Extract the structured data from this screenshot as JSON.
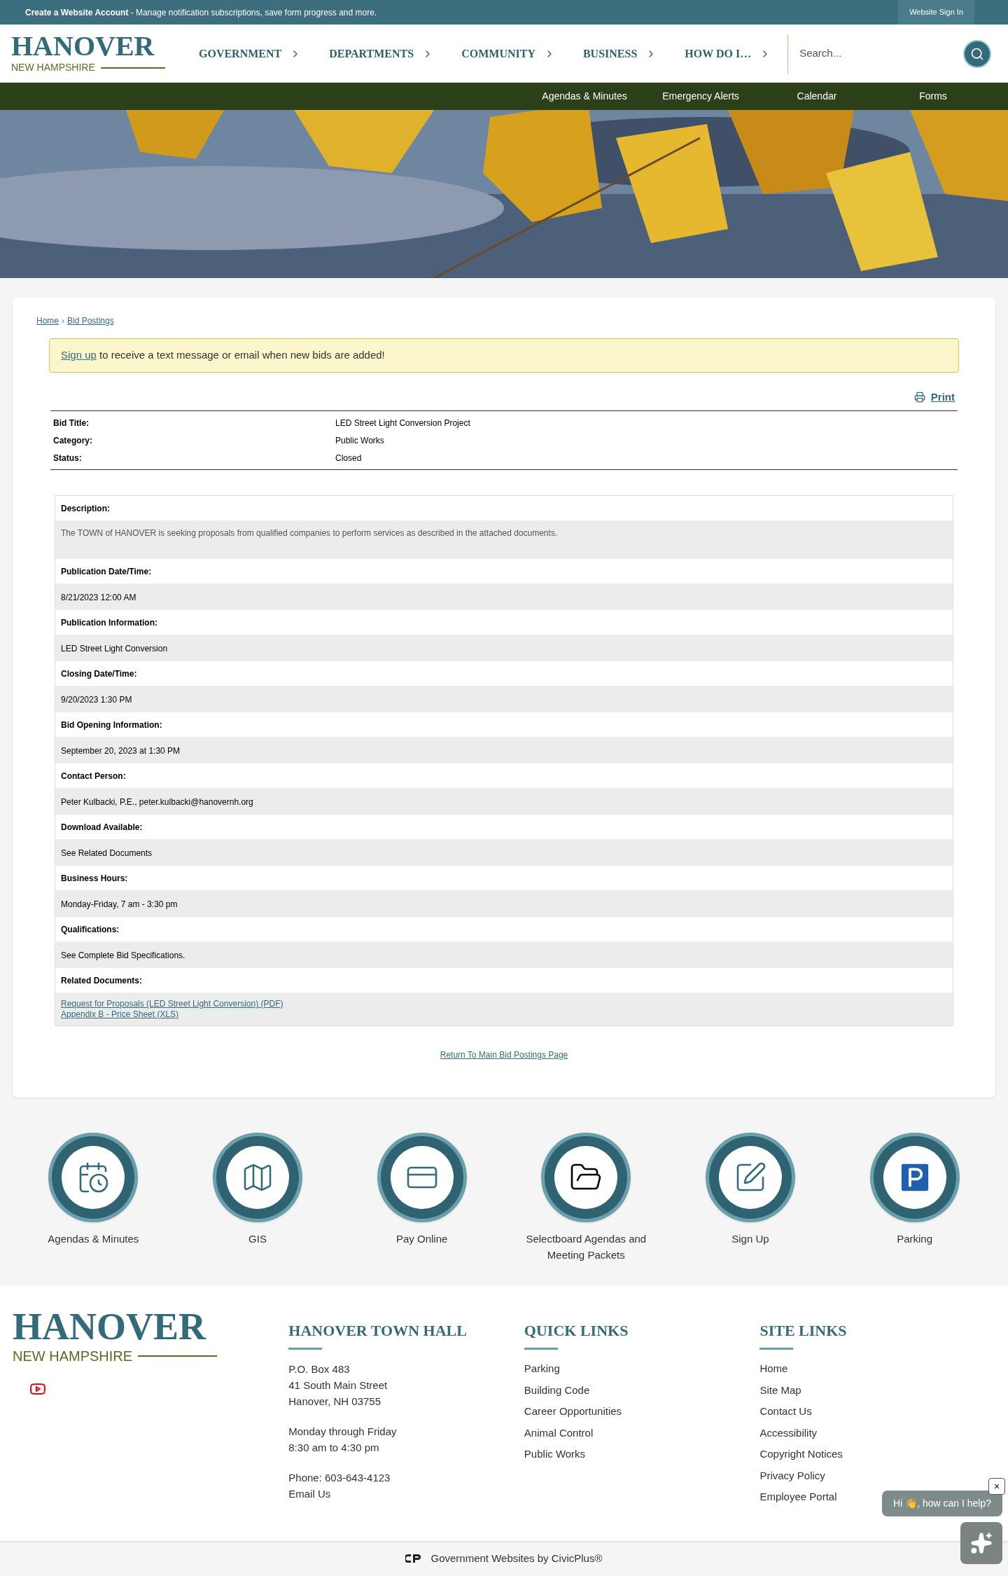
{
  "top_bar": {
    "account_link": "Create a Website Account",
    "account_text": " - Manage notification subscriptions, save form progress and more.",
    "sign_in": "Website Sign In"
  },
  "header_logo": {
    "title": "HANOVER",
    "subtitle": "NEW HAMPSHIRE"
  },
  "nav": [
    "GOVERNMENT",
    "DEPARTMENTS",
    "COMMUNITY",
    "BUSINESS",
    "HOW DO I…"
  ],
  "search": {
    "placeholder": "Search..."
  },
  "subnav": [
    "Agendas & Minutes",
    "Emergency Alerts",
    "Calendar",
    "Forms"
  ],
  "banner": {
    "kind": "picture"
  },
  "breadcrumb": {
    "items": [
      "Home",
      "Bid Postings"
    ],
    "separator": "›"
  },
  "notice": {
    "link": "Sign up",
    "text": " to receive a text message or email when new bids are added!"
  },
  "print": "Print",
  "summary": [
    {
      "label": "Bid Title:",
      "value": "LED Street Light Conversion Project"
    },
    {
      "label": "Category:",
      "value": "Public Works"
    },
    {
      "label": "Status:",
      "value": "Closed"
    }
  ],
  "details": [
    {
      "label": "Description:",
      "kind": "text",
      "value": "The TOWN of HANOVER is seeking proposals from qualified companies to perform services as described in the attached documents."
    },
    {
      "label": "Publication Date/Time:",
      "kind": "text",
      "value": "8/21/2023 12:00 AM"
    },
    {
      "label": "Publication Information:",
      "kind": "text",
      "value": "LED Street Light Conversion"
    },
    {
      "label": "Closing Date/Time:",
      "kind": "text",
      "value": "9/20/2023 1:30 PM"
    },
    {
      "label": "Bid Opening Information:",
      "kind": "text",
      "value": "September 20, 2023 at 1:30 PM"
    },
    {
      "label": "Contact Person:",
      "kind": "text",
      "value": "Peter Kulbacki, P.E., peter.kulbacki@hanovernh.org"
    },
    {
      "label": "Download Available:",
      "kind": "text",
      "value": "See Related Documents"
    },
    {
      "label": "Business Hours:",
      "kind": "text",
      "value": "Monday-Friday, 7 am - 3:30 pm"
    },
    {
      "label": "Qualifications:",
      "kind": "text",
      "value": "See Complete Bid Specifications."
    },
    {
      "label": "Related Documents:",
      "kind": "links",
      "links": [
        "Request for Proposals (LED Street Light Conversion) (PDF)",
        "Appendix B - Price Sheet (XLS)"
      ]
    }
  ],
  "return_link": "Return To Main Bid Postings Page",
  "quick_icons": [
    {
      "label": "Agendas & Minutes",
      "kind": "calendar"
    },
    {
      "label": "GIS",
      "kind": "map"
    },
    {
      "label": "Pay Online",
      "kind": "card"
    },
    {
      "label": "Selectboard Agendas and Meeting Packets",
      "kind": "folder"
    },
    {
      "label": "Sign Up",
      "kind": "pen"
    },
    {
      "label": "Parking",
      "kind": "parking"
    }
  ],
  "footer": {
    "logo": {
      "title": "HANOVER",
      "subtitle": "NEW HAMPSHIRE"
    },
    "town_hall": {
      "heading": "HANOVER TOWN HALL",
      "groups": [
        [
          "P.O. Box 483",
          "41 South Main Street",
          "Hanover, NH 03755"
        ],
        [
          "Monday through Friday",
          "8:30 am to 4:30 pm"
        ],
        [
          "Phone: 603-643-4123",
          "Email Us"
        ]
      ]
    },
    "quick_links": {
      "heading": "QUICK LINKS",
      "items": [
        "Parking",
        "Building Code",
        "Career Opportunities",
        "Animal Control",
        "Public Works"
      ]
    },
    "site_links": {
      "heading": "SITE LINKS",
      "items": [
        "Home",
        "Site Map",
        "Contact Us",
        "Accessibility",
        "Copyright Notices",
        "Privacy Policy",
        "Employee Portal"
      ]
    }
  },
  "chat": {
    "greeting": "Hi 👋, how can I help?",
    "close": "×"
  },
  "credit": "Government Websites by CivicPlus®"
}
